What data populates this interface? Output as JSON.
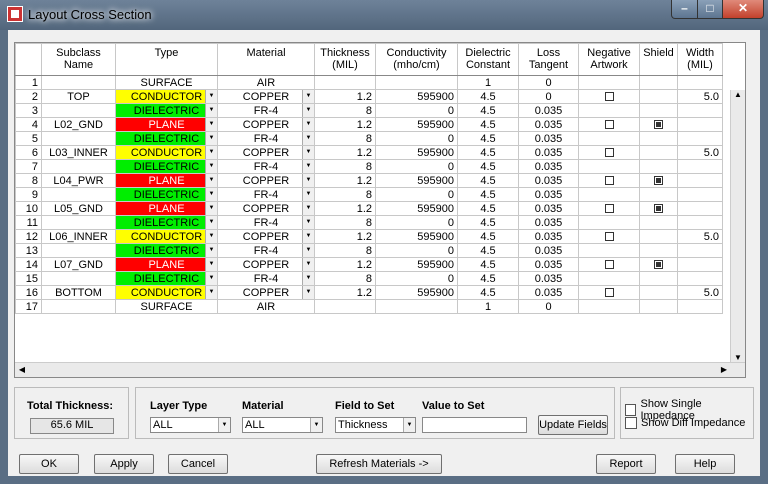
{
  "window": {
    "title": "Layout Cross Section"
  },
  "grid": {
    "headers": [
      "",
      "Subclass Name",
      "Type",
      "Material",
      "Thickness\n(MIL)",
      "Conductivity\n(mho/cm)",
      "Dielectric\nConstant",
      "Loss\nTangent",
      "Negative\nArtwork",
      "Shield",
      "Width\n(MIL)"
    ],
    "rows": [
      {
        "n": "1",
        "name": "",
        "type": "SURFACE",
        "mat": "AIR",
        "th": "",
        "cond": "",
        "dc": "1",
        "lt": "0",
        "neg": null,
        "sh": null,
        "w": ""
      },
      {
        "n": "2",
        "name": "TOP",
        "type": "CONDUCTOR",
        "mat": "COPPER",
        "th": "1.2",
        "cond": "595900",
        "dc": "4.5",
        "lt": "0",
        "neg": false,
        "sh": null,
        "w": "5.0"
      },
      {
        "n": "3",
        "name": "",
        "type": "DIELECTRIC",
        "mat": "FR-4",
        "th": "8",
        "cond": "0",
        "dc": "4.5",
        "lt": "0.035",
        "neg": null,
        "sh": null,
        "w": ""
      },
      {
        "n": "4",
        "name": "L02_GND",
        "type": "PLANE",
        "mat": "COPPER",
        "th": "1.2",
        "cond": "595900",
        "dc": "4.5",
        "lt": "0.035",
        "neg": false,
        "sh": true,
        "w": ""
      },
      {
        "n": "5",
        "name": "",
        "type": "DIELECTRIC",
        "mat": "FR-4",
        "th": "8",
        "cond": "0",
        "dc": "4.5",
        "lt": "0.035",
        "neg": null,
        "sh": null,
        "w": ""
      },
      {
        "n": "6",
        "name": "L03_INNER",
        "type": "CONDUCTOR",
        "mat": "COPPER",
        "th": "1.2",
        "cond": "595900",
        "dc": "4.5",
        "lt": "0.035",
        "neg": false,
        "sh": null,
        "w": "5.0"
      },
      {
        "n": "7",
        "name": "",
        "type": "DIELECTRIC",
        "mat": "FR-4",
        "th": "8",
        "cond": "0",
        "dc": "4.5",
        "lt": "0.035",
        "neg": null,
        "sh": null,
        "w": ""
      },
      {
        "n": "8",
        "name": "L04_PWR",
        "type": "PLANE",
        "mat": "COPPER",
        "th": "1.2",
        "cond": "595900",
        "dc": "4.5",
        "lt": "0.035",
        "neg": false,
        "sh": true,
        "w": ""
      },
      {
        "n": "9",
        "name": "",
        "type": "DIELECTRIC",
        "mat": "FR-4",
        "th": "8",
        "cond": "0",
        "dc": "4.5",
        "lt": "0.035",
        "neg": null,
        "sh": null,
        "w": ""
      },
      {
        "n": "10",
        "name": "L05_GND",
        "type": "PLANE",
        "mat": "COPPER",
        "th": "1.2",
        "cond": "595900",
        "dc": "4.5",
        "lt": "0.035",
        "neg": false,
        "sh": true,
        "w": ""
      },
      {
        "n": "11",
        "name": "",
        "type": "DIELECTRIC",
        "mat": "FR-4",
        "th": "8",
        "cond": "0",
        "dc": "4.5",
        "lt": "0.035",
        "neg": null,
        "sh": null,
        "w": ""
      },
      {
        "n": "12",
        "name": "L06_INNER",
        "type": "CONDUCTOR",
        "mat": "COPPER",
        "th": "1.2",
        "cond": "595900",
        "dc": "4.5",
        "lt": "0.035",
        "neg": false,
        "sh": null,
        "w": "5.0"
      },
      {
        "n": "13",
        "name": "",
        "type": "DIELECTRIC",
        "mat": "FR-4",
        "th": "8",
        "cond": "0",
        "dc": "4.5",
        "lt": "0.035",
        "neg": null,
        "sh": null,
        "w": ""
      },
      {
        "n": "14",
        "name": "L07_GND",
        "type": "PLANE",
        "mat": "COPPER",
        "th": "1.2",
        "cond": "595900",
        "dc": "4.5",
        "lt": "0.035",
        "neg": false,
        "sh": true,
        "w": ""
      },
      {
        "n": "15",
        "name": "",
        "type": "DIELECTRIC",
        "mat": "FR-4",
        "th": "8",
        "cond": "0",
        "dc": "4.5",
        "lt": "0.035",
        "neg": null,
        "sh": null,
        "w": ""
      },
      {
        "n": "16",
        "name": "BOTTOM",
        "type": "CONDUCTOR",
        "mat": "COPPER",
        "th": "1.2",
        "cond": "595900",
        "dc": "4.5",
        "lt": "0.035",
        "neg": false,
        "sh": null,
        "w": "5.0"
      },
      {
        "n": "17",
        "name": "",
        "type": "SURFACE",
        "mat": "AIR",
        "th": "",
        "cond": "",
        "dc": "1",
        "lt": "0",
        "neg": null,
        "sh": null,
        "w": ""
      }
    ]
  },
  "total": {
    "label": "Total Thickness:",
    "value": "65.6 MIL"
  },
  "fields": {
    "layer_type_label": "Layer Type",
    "layer_type_value": "ALL",
    "material_label": "Material",
    "material_value": "ALL",
    "field_to_set_label": "Field to Set",
    "field_to_set_value": "Thickness",
    "value_to_set_label": "Value to Set",
    "value_to_set_value": "",
    "update_fields": "Update Fields"
  },
  "options": {
    "single_impedance": "Show Single Impedance",
    "diff_impedance": "Show Diff Impedance"
  },
  "buttons": {
    "ok": "OK",
    "apply": "Apply",
    "cancel": "Cancel",
    "refresh": "Refresh Materials ->",
    "report": "Report",
    "help": "Help"
  },
  "colors": {
    "conductor": "#ffff00",
    "dielectric": "#00ee00",
    "plane": "#ff0000"
  }
}
